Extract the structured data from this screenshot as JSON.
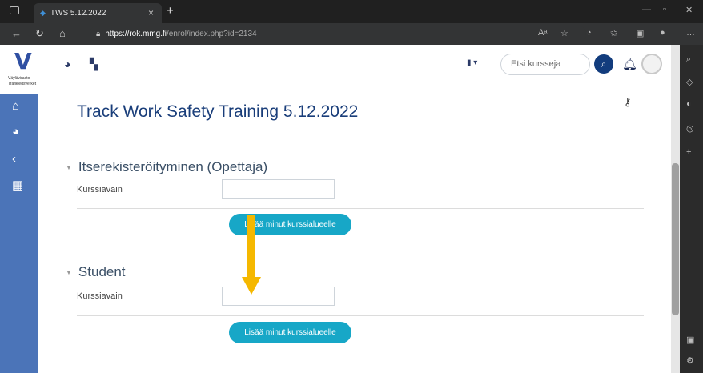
{
  "browser": {
    "tab_title": "TWS 5.12.2022",
    "tab_close": "×",
    "new_tab": "+",
    "url_host": "https://rok.mmg.fi",
    "url_path": "/enrol/index.php?id=2134"
  },
  "header": {
    "logo_letter": "V",
    "logo_line1": "Väylävirasto",
    "logo_line2": "Trafikledsverket",
    "search_placeholder": "Etsi kursseja"
  },
  "main": {
    "title": "Track Work Safety Training 5.12.2022",
    "sections": [
      {
        "heading": "Itserekisteröityminen (Opettaja)",
        "field_label": "Kurssiavain",
        "button_label": "Lisää minut kurssialueelle"
      },
      {
        "heading": "Student",
        "field_label": "Kurssiavain",
        "button_label": "Lisää minut kurssialueelle"
      }
    ]
  },
  "annotation": {
    "arrow_color": "#f5b800"
  },
  "colors": {
    "sidebar": "#4b74b8",
    "accent_button": "#17a7c7",
    "title": "#1a3e7a"
  }
}
